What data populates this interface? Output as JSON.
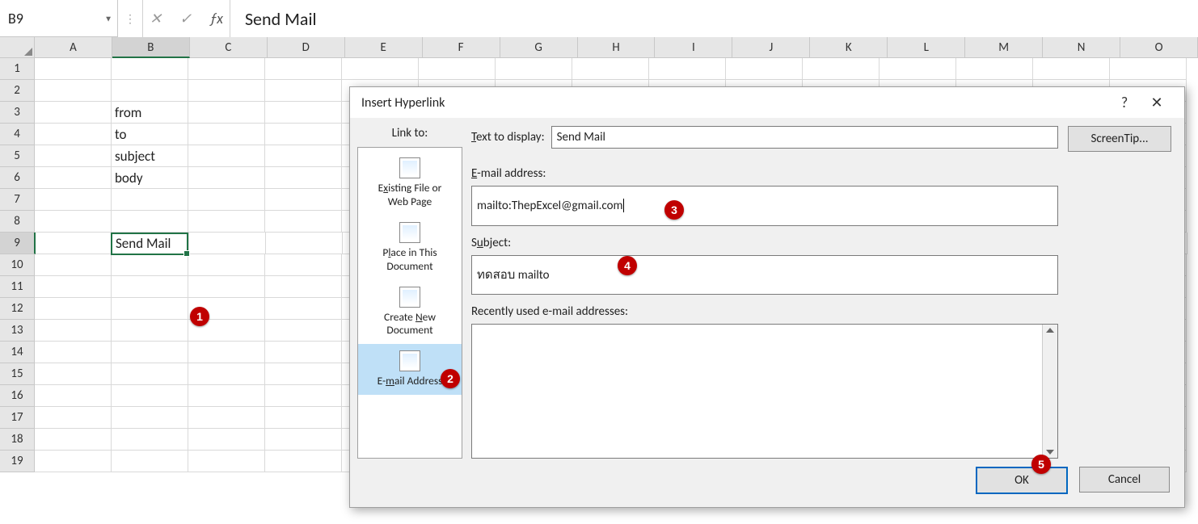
{
  "namebox": "B9",
  "formula_bar_text": "Send Mail",
  "columns": [
    "A",
    "B",
    "C",
    "D",
    "E",
    "F",
    "G",
    "H",
    "I",
    "J",
    "K",
    "L",
    "M",
    "N",
    "O"
  ],
  "row_count": 19,
  "active": {
    "col_index": 1,
    "row_index": 8
  },
  "cells": {
    "B3": "from",
    "B4": "to",
    "B5": "subject",
    "B6": "body",
    "B9": "Send Mail"
  },
  "dialog": {
    "title": "Insert Hyperlink",
    "help": "?",
    "close": "✕",
    "linkto_label": "Link to:",
    "linkto_items": [
      {
        "label_a": "Existing File or",
        "label_b": "Web Page",
        "u": "x"
      },
      {
        "label_a": "Place in This",
        "label_b": "Document",
        "u": "l"
      },
      {
        "label_a": "Create New",
        "label_b": "Document",
        "u": "N"
      },
      {
        "label_a": "E-mail Address",
        "label_b": "",
        "u": "m",
        "selected": true
      }
    ],
    "text_to_display_label": "Text to display:",
    "text_to_display": "Send Mail",
    "email_label": "E-mail address:",
    "email_value": "mailto:ThepExcel@gmail.com",
    "subject_label": "Subject:",
    "subject_value": "ทดสอบ mailto",
    "recent_label": "Recently used e-mail addresses:",
    "screentip_btn": "ScreenTip...",
    "ok_btn": "OK",
    "cancel_btn": "Cancel"
  },
  "badges": {
    "1": "1",
    "2": "2",
    "3": "3",
    "4": "4",
    "5": "5"
  }
}
